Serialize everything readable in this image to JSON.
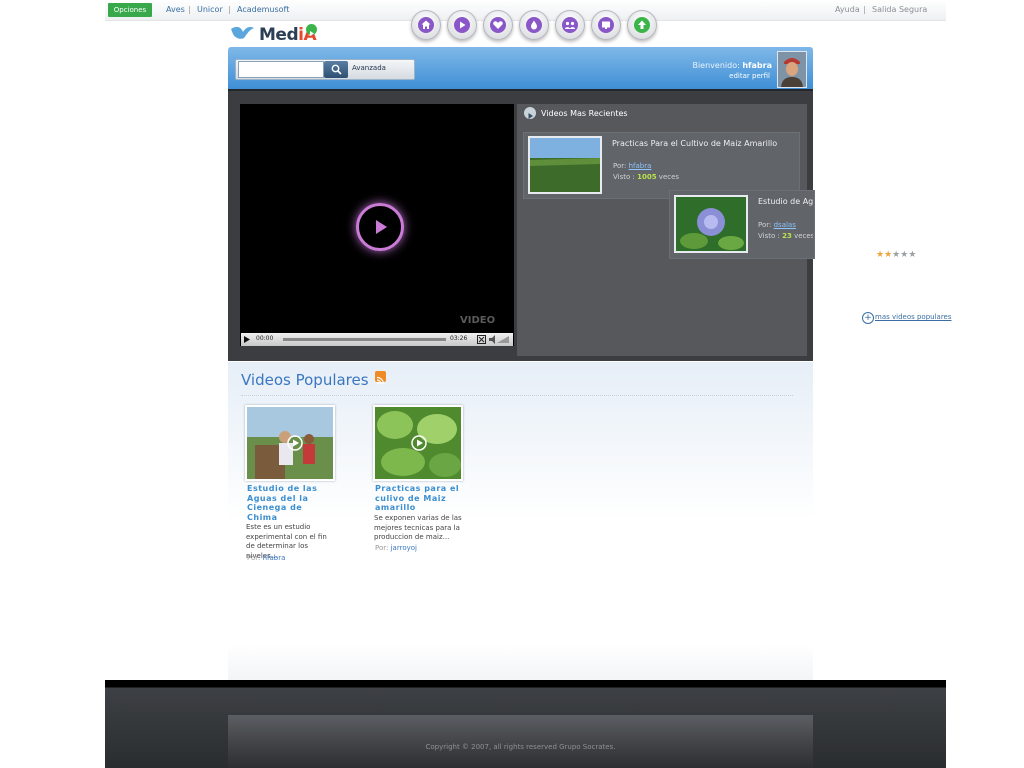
{
  "topbar": {
    "options_label": "Opciones",
    "links": [
      "Aves",
      "Unicor",
      "Academusoft"
    ],
    "right_links": [
      "Ayuda",
      "Salida Segura"
    ],
    "separator": "|"
  },
  "logo": {
    "text_main": "Med",
    "text_accent": "iA"
  },
  "nav": {
    "icons": [
      "home-icon",
      "play-icon",
      "heart-icon",
      "drop-icon",
      "people-icon",
      "screen-icon",
      "upload-icon"
    ]
  },
  "search": {
    "value": "",
    "placeholder": "",
    "advanced_label": "Avanzada"
  },
  "user": {
    "welcome_label": "Bienvenido:",
    "username": "hfabra",
    "edit_profile_label": "editar perfil"
  },
  "player": {
    "time_current": "00:00",
    "time_total": "03:26",
    "watermark": "VIDEO"
  },
  "recent": {
    "title": "Videos Mas Recientes",
    "items": [
      {
        "title": "Practicas Para el Cultivo de Maiz Amarillo",
        "by_label": "Por:",
        "author": "hfabra",
        "views_label": "Visto :",
        "views": "1005",
        "views_suffix": "veces",
        "rating": 3
      },
      {
        "title": "Estudio de Aguas de Chima Cor",
        "by_label": "Por:",
        "author": "dsalas",
        "views_label": "Visto :",
        "views": "23",
        "views_suffix": "veces",
        "rating": 2
      }
    ]
  },
  "popular": {
    "title": "Videos Populares",
    "items": [
      {
        "title": "Estudio de las Aguas del la Cienega de Chima",
        "description": "Este es un estudio experimental con el fin de determinar los niveles...",
        "by_label": "Por:",
        "author": "hfabra"
      },
      {
        "title": "Practicas para el culivo de Maiz amarillo",
        "description": "Se exponen varias de las mejores tecnicas para la produccion de maiz...",
        "by_label": "Por:",
        "author": "jarroyoj"
      }
    ],
    "more_label": "mas videos populares"
  },
  "footer": {
    "copyright": "Copyright © 2007, all rights reserved Grupo Socrates."
  },
  "colors": {
    "accent_blue": "#3a77c0",
    "header_blue": "#3f8fd6",
    "options_green": "#39a84a",
    "star_on": "#f0a43a",
    "star_off": "#9aa0a6"
  }
}
